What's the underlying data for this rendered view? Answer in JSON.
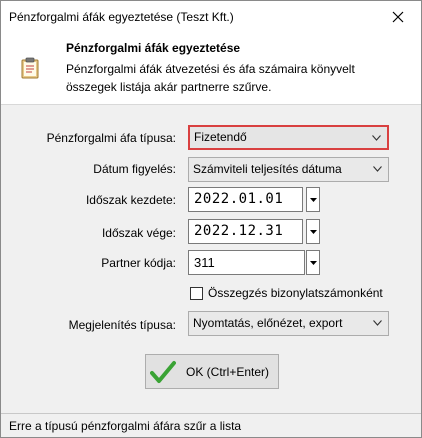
{
  "window": {
    "title": "Pénzforgalmi áfák egyeztetése (Teszt Kft.)"
  },
  "header": {
    "title": "Pénzforgalmi áfák egyeztetése",
    "description": "Pénzforgalmi áfák átvezetési és áfa számaira könyvelt összegek listája akár partnerre szűrve."
  },
  "form": {
    "afa_type": {
      "label": "Pénzforgalmi áfa típusa:",
      "value": "Fizetendő"
    },
    "date_watch": {
      "label": "Dátum figyelés:",
      "value": "Számviteli teljesítés dátuma"
    },
    "period_start": {
      "label": "Időszak kezdete:",
      "value": "2022.01.01"
    },
    "period_end": {
      "label": "Időszak vége:",
      "value": "2022.12.31"
    },
    "partner_code": {
      "label": "Partner kódja:",
      "value": "311"
    },
    "summarize": {
      "label": "Összegzés bizonylatszámonként",
      "checked": false
    },
    "display_type": {
      "label": "Megjelenítés típusa:",
      "value": "Nyomtatás, előnézet, export"
    }
  },
  "ok_button": {
    "label": "OK (Ctrl+Enter)"
  },
  "status_bar": {
    "text": "Erre a típusú pénzforgalmi áfára szűr a lista"
  },
  "colors": {
    "highlight_border": "#d94040",
    "ok_check": "#3aa335"
  },
  "icons": [
    "close-icon",
    "clipboard-icon",
    "chevron-down-icon",
    "dropdown-arrow-icon",
    "checkmark-icon"
  ]
}
